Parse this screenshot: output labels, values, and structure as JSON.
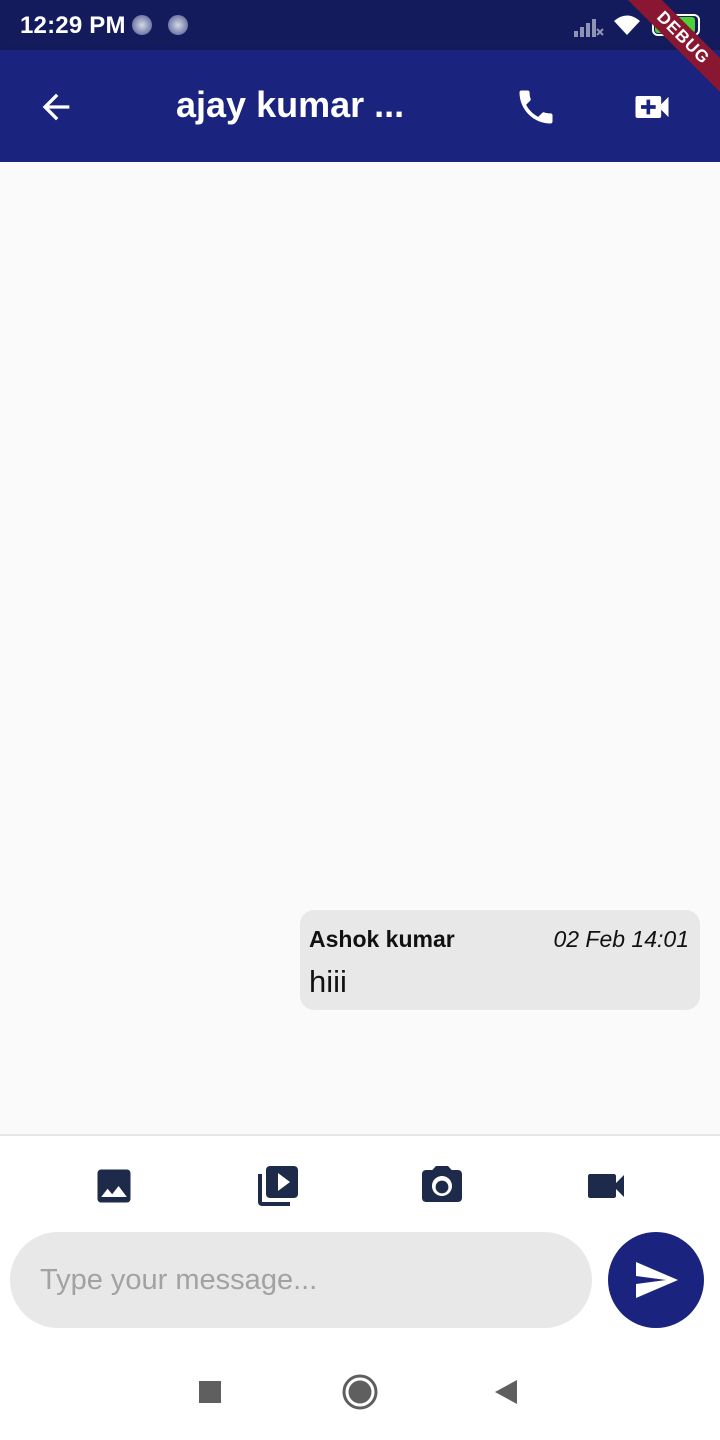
{
  "status_bar": {
    "time": "12:29 PM",
    "battery_level": "91",
    "icons": [
      "notification-dot-icon",
      "notification-dot-icon",
      "signal-icon",
      "wifi-icon",
      "battery-icon"
    ]
  },
  "debug_banner": "DEBUG",
  "app_bar": {
    "title": "ajay kumar ...",
    "back_icon": "arrow-back-icon",
    "call_icon": "phone-icon",
    "video_icon": "video-call-icon",
    "background_color": "#1a237e"
  },
  "messages": [
    {
      "sender": "Ashok kumar",
      "time": "02 Feb 14:01",
      "text": "hiii"
    }
  ],
  "composer": {
    "attachments": [
      "image-icon",
      "video-library-icon",
      "camera-icon",
      "videocam-icon"
    ],
    "placeholder": "Type your message...",
    "value": "",
    "send_icon": "send-icon"
  },
  "nav_bar": {
    "buttons": [
      "recents-icon",
      "home-icon",
      "back-icon"
    ]
  },
  "colors": {
    "primary": "#1a237e",
    "status_bar": "#141b5c",
    "icon_dark": "#1e2a4a",
    "bubble": "#e8e8e8",
    "battery_green": "#4cd137",
    "debug_red": "#8a1732"
  }
}
